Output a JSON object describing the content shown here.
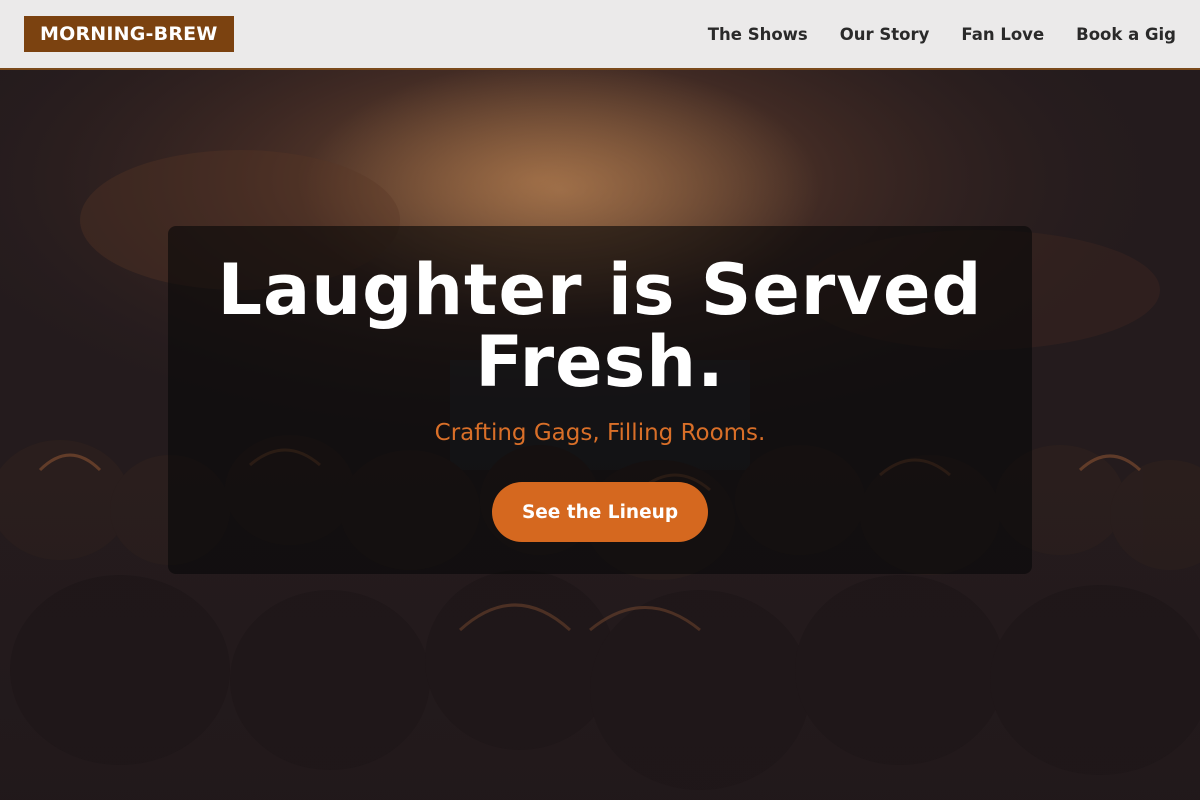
{
  "header": {
    "logo": "MORNING-BREW",
    "nav": [
      {
        "label": "The Shows"
      },
      {
        "label": "Our Story"
      },
      {
        "label": "Fan Love"
      },
      {
        "label": "Book a Gig"
      }
    ]
  },
  "hero": {
    "title": "Laughter is Served Fresh.",
    "subtitle": "Crafting Gags, Filling Rooms.",
    "cta_label": "See the Lineup",
    "background": "concert-crowd-photo"
  },
  "colors": {
    "brand": "#7b4210",
    "accent": "#d5681f",
    "subtitle": "#d96f28",
    "header_bg": "#ebeaea",
    "page_bg": "#231a1c"
  }
}
